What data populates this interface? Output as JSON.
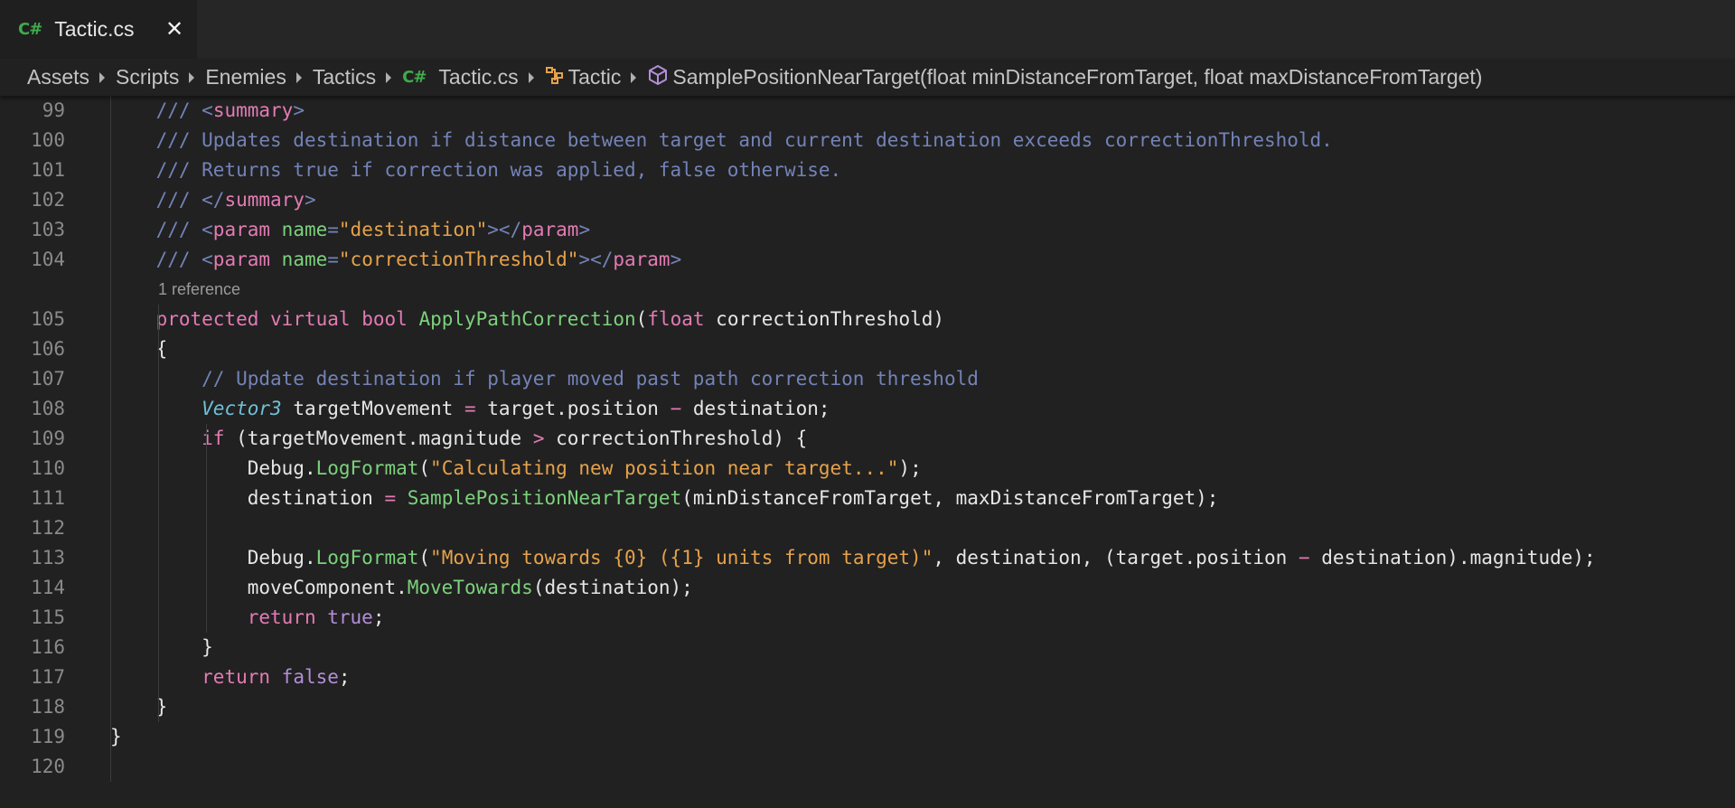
{
  "tab": {
    "icon": "C#",
    "title": "Tactic.cs",
    "close": "✕"
  },
  "breadcrumb": {
    "items": [
      "Assets",
      "Scripts",
      "Enemies",
      "Tactics",
      "Tactic.cs",
      "Tactic",
      "SamplePositionNearTarget(float minDistanceFromTarget, float maxDistanceFromTarget)"
    ],
    "file_icon": "C#",
    "icons": [
      "csharp-file-icon",
      "class-icon",
      "method-cube-icon"
    ]
  },
  "editor": {
    "codelens": "1 reference",
    "line_numbers": [
      "99",
      "100",
      "101",
      "102",
      "103",
      "104",
      "105",
      "106",
      "107",
      "108",
      "109",
      "110",
      "111",
      "112",
      "113",
      "114",
      "115",
      "116",
      "117",
      "118",
      "119",
      "120"
    ],
    "lines": [
      [
        [
          "c-comment",
          "/// "
        ],
        [
          "c-comment",
          "<"
        ],
        [
          "c-tag",
          "summary"
        ],
        [
          "c-comment",
          ">"
        ]
      ],
      [
        [
          "c-comment",
          "/// Updates destination if distance between target and current destination exceeds correctionThreshold."
        ]
      ],
      [
        [
          "c-comment",
          "/// Returns true if correction was applied, false otherwise."
        ]
      ],
      [
        [
          "c-comment",
          "/// </"
        ],
        [
          "c-tag",
          "summary"
        ],
        [
          "c-comment",
          ">"
        ]
      ],
      [
        [
          "c-comment",
          "/// <"
        ],
        [
          "c-tag",
          "param"
        ],
        [
          "c-plain",
          " "
        ],
        [
          "c-attr",
          "name"
        ],
        [
          "c-comment",
          "="
        ],
        [
          "c-string",
          "\"destination\""
        ],
        [
          "c-comment",
          "></"
        ],
        [
          "c-tag",
          "param"
        ],
        [
          "c-comment",
          ">"
        ]
      ],
      [
        [
          "c-comment",
          "/// <"
        ],
        [
          "c-tag",
          "param"
        ],
        [
          "c-plain",
          " "
        ],
        [
          "c-attr",
          "name"
        ],
        [
          "c-comment",
          "="
        ],
        [
          "c-string",
          "\"correctionThreshold\""
        ],
        [
          "c-comment",
          "></"
        ],
        [
          "c-tag",
          "param"
        ],
        [
          "c-comment",
          ">"
        ]
      ],
      [
        [
          "c-kw",
          "protected"
        ],
        [
          "c-plain",
          " "
        ],
        [
          "c-kw",
          "virtual"
        ],
        [
          "c-plain",
          " "
        ],
        [
          "c-kw",
          "bool"
        ],
        [
          "c-plain",
          " "
        ],
        [
          "c-fn",
          "ApplyPathCorrection"
        ],
        [
          "c-plain",
          "("
        ],
        [
          "c-kw",
          "float"
        ],
        [
          "c-plain",
          " correctionThreshold)"
        ]
      ],
      [
        [
          "c-plain",
          "{"
        ]
      ],
      [
        [
          "c-comment",
          "    // Update destination if player moved past path correction threshold"
        ]
      ],
      [
        [
          "c-plain",
          "    "
        ],
        [
          "c-type",
          "Vector3"
        ],
        [
          "c-plain",
          " targetMovement "
        ],
        [
          "c-op",
          "="
        ],
        [
          "c-plain",
          " target.position "
        ],
        [
          "c-op",
          "−"
        ],
        [
          "c-plain",
          " destination;"
        ]
      ],
      [
        [
          "c-plain",
          "    "
        ],
        [
          "c-kw",
          "if"
        ],
        [
          "c-plain",
          " (targetMovement.magnitude "
        ],
        [
          "c-op",
          ">"
        ],
        [
          "c-plain",
          " correctionThreshold) {"
        ]
      ],
      [
        [
          "c-plain",
          "        Debug."
        ],
        [
          "c-fn",
          "LogFormat"
        ],
        [
          "c-plain",
          "("
        ],
        [
          "c-string",
          "\"Calculating new position near target...\""
        ],
        [
          "c-plain",
          ");"
        ]
      ],
      [
        [
          "c-plain",
          "        destination "
        ],
        [
          "c-op",
          "="
        ],
        [
          "c-plain",
          " "
        ],
        [
          "c-fn",
          "SamplePositionNearTarget"
        ],
        [
          "c-plain",
          "(minDistanceFromTarget, maxDistanceFromTarget);"
        ]
      ],
      [
        [
          "c-plain",
          ""
        ]
      ],
      [
        [
          "c-plain",
          "        Debug."
        ],
        [
          "c-fn",
          "LogFormat"
        ],
        [
          "c-plain",
          "("
        ],
        [
          "c-string",
          "\"Moving towards {0} ({1} units from target)\""
        ],
        [
          "c-plain",
          ", destination, (target.position "
        ],
        [
          "c-op",
          "−"
        ],
        [
          "c-plain",
          " destination).magnitude);"
        ]
      ],
      [
        [
          "c-plain",
          "        moveComponent."
        ],
        [
          "c-fn",
          "MoveTowards"
        ],
        [
          "c-plain",
          "(destination);"
        ]
      ],
      [
        [
          "c-plain",
          "        "
        ],
        [
          "c-kw",
          "return"
        ],
        [
          "c-plain",
          " "
        ],
        [
          "c-bool",
          "true"
        ],
        [
          "c-plain",
          ";"
        ]
      ],
      [
        [
          "c-plain",
          "    }"
        ]
      ],
      [
        [
          "c-plain",
          "    "
        ],
        [
          "c-kw",
          "return"
        ],
        [
          "c-plain",
          " "
        ],
        [
          "c-bool",
          "false"
        ],
        [
          "c-plain",
          ";"
        ]
      ],
      [
        [
          "c-plain",
          "}"
        ]
      ],
      [
        [
          "c-plain",
          "}"
        ]
      ],
      [
        [
          "c-plain",
          ""
        ]
      ]
    ]
  },
  "colors": {
    "background": "#212121",
    "tabbar": "#262626",
    "csharp_icon": "#3faa4d",
    "comment": "#7383b8",
    "keyword": "#e37bb4",
    "function": "#7cd17c",
    "string": "#e6a24a",
    "type": "#6fc0d6",
    "boolean": "#b38ed9"
  }
}
